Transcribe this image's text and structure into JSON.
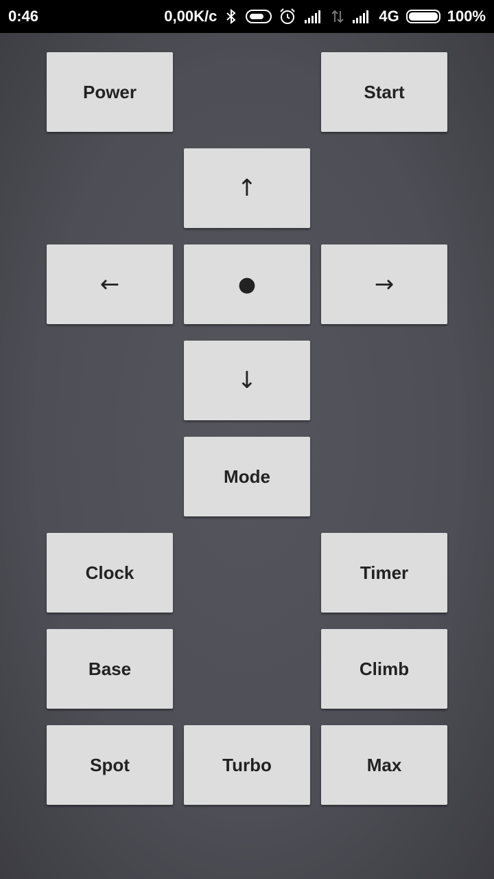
{
  "status_bar": {
    "time": "0:46",
    "network_speed": "0,00K/c",
    "network_type": "4G",
    "battery": "100%",
    "battery_level": 1.0,
    "icons": [
      "bluetooth-icon",
      "toggle-icon",
      "alarm-icon",
      "signal-icon",
      "data-arrows-icon",
      "signal-icon"
    ]
  },
  "remote": {
    "power": "Power",
    "start": "Start",
    "up": "↑",
    "left": "←",
    "center": "●",
    "right": "→",
    "down": "↓",
    "mode": "Mode",
    "clock": "Clock",
    "timer": "Timer",
    "base": "Base",
    "climb": "Climb",
    "spot": "Spot",
    "turbo": "Turbo",
    "max": "Max"
  },
  "colors": {
    "background": "#4e4e56",
    "button": "#dcdddc",
    "button_text": "#222222",
    "status_bar": "#000000"
  }
}
